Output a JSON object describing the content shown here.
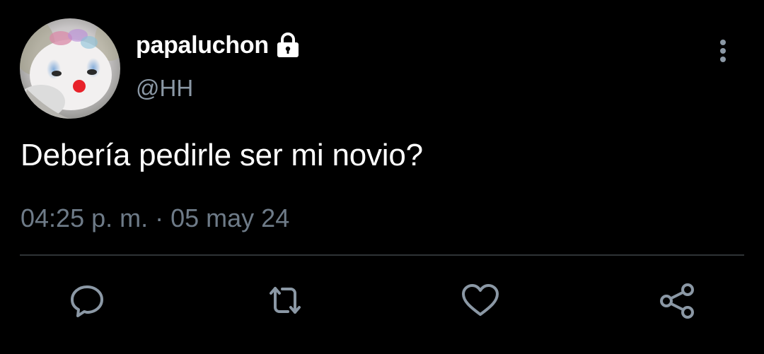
{
  "tweet": {
    "author": {
      "display_name": "papaluchon",
      "handle": "@HH",
      "protected_icon": "lock-icon",
      "avatar": "clown-cat-avatar"
    },
    "text": "Debería pedirle ser mi novio?",
    "time": "04:25 p. m.",
    "separator": "·",
    "date": "05 may 24"
  },
  "menu": {
    "icon": "more-vertical-icon"
  },
  "actions": [
    {
      "name": "reply",
      "icon": "reply-icon"
    },
    {
      "name": "retweet",
      "icon": "retweet-icon"
    },
    {
      "name": "like",
      "icon": "heart-icon"
    },
    {
      "name": "share",
      "icon": "share-icon"
    }
  ],
  "colors": {
    "background": "#000000",
    "primary_text": "#ffffff",
    "secondary_text": "#8b98a5",
    "divider": "#2f3336",
    "icon": "#8b98a5"
  }
}
